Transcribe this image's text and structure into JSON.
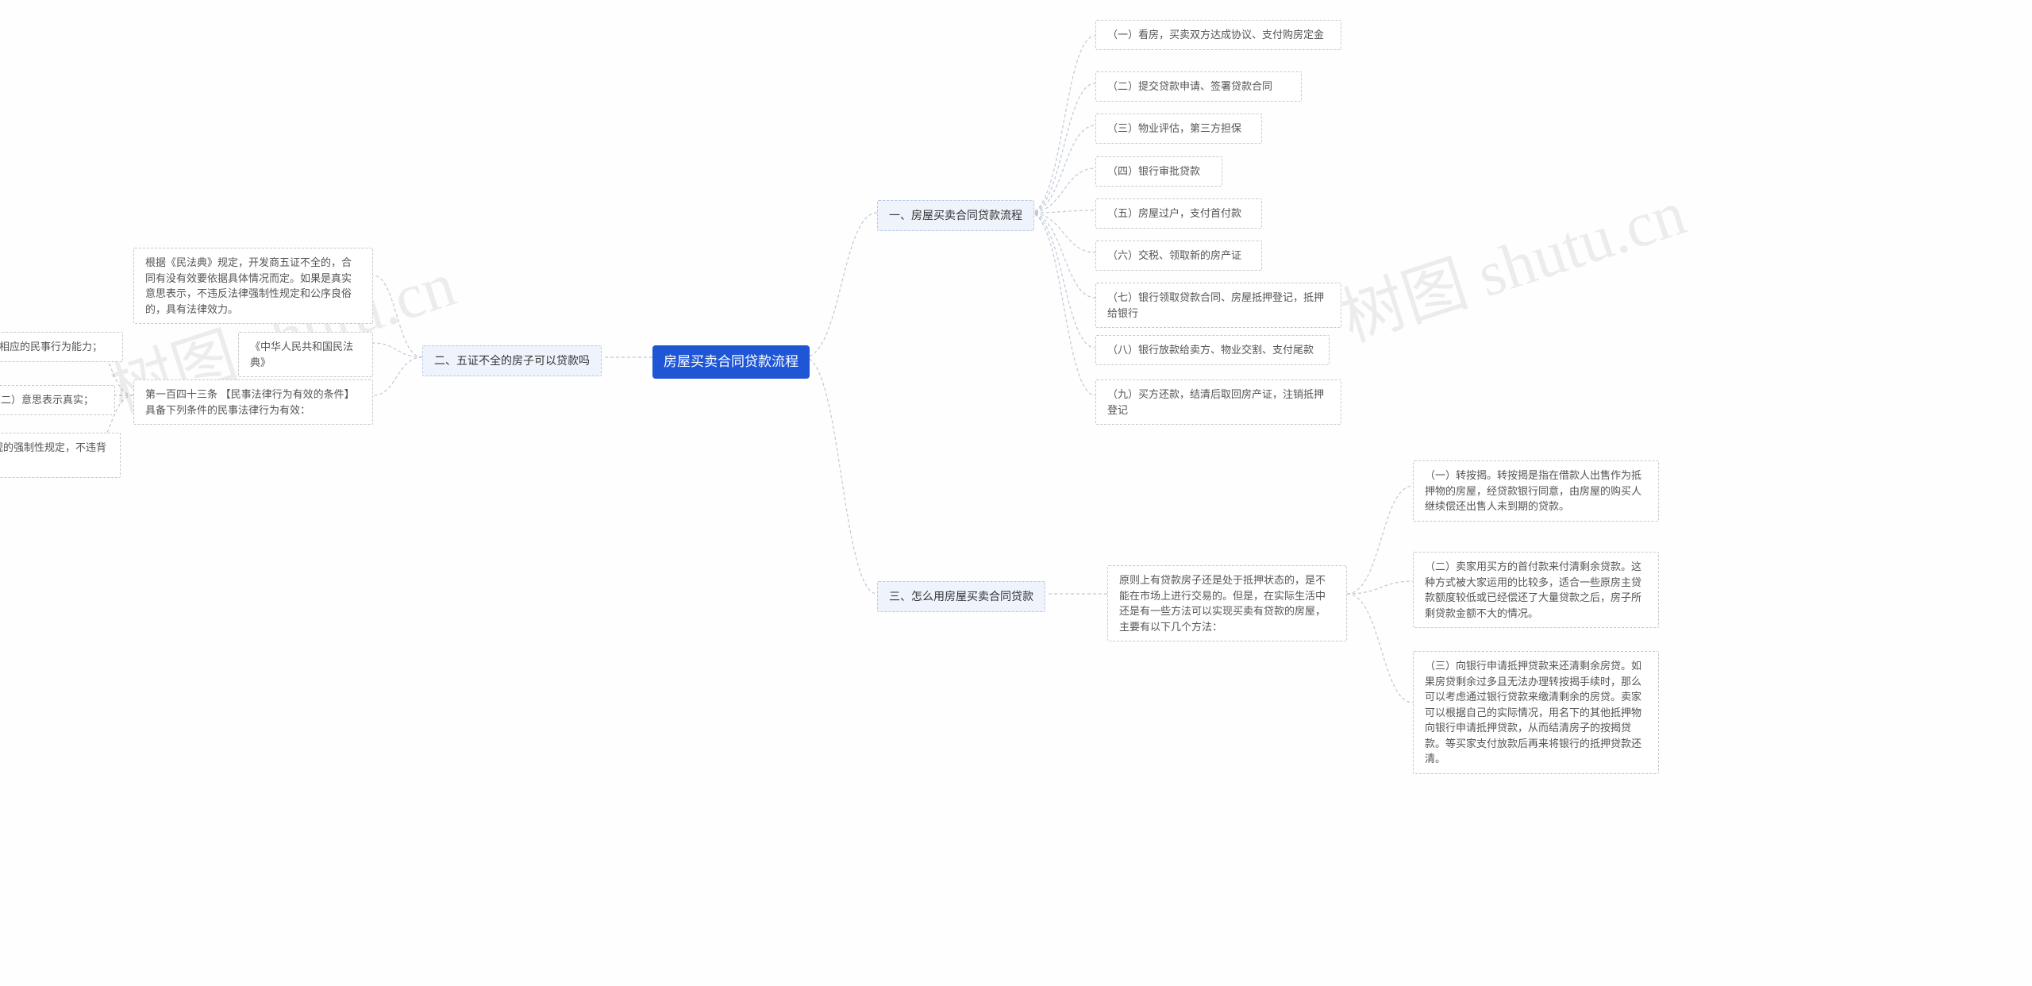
{
  "center": "房屋买卖合同贷款流程",
  "branch1": {
    "title": "一、房屋买卖合同贷款流程",
    "items": [
      "（一）看房，买卖双方达成协议、支付购房定金",
      "（二）提交贷款申请、签署贷款合同",
      "（三）物业评估，第三方担保",
      "（四）银行审批贷款",
      "（五）房屋过户，支付首付款",
      "（六）交税、领取新的房产证",
      "（七）银行领取贷款合同、房屋抵押登记，抵押给银行",
      "（八）银行放款给卖方、物业交割、支付尾款",
      "（九）买方还款，结清后取回房产证，注销抵押登记"
    ]
  },
  "branch2": {
    "title": "二、五证不全的房子可以贷款吗",
    "item1": "根据《民法典》规定，开发商五证不全的，合同有没有效要依据具体情况而定。如果是真实意思表示，不违反法律强制性规定和公序良俗的，具有法律效力。",
    "item2": "《中华人民共和国民法典》",
    "item3": "第一百四十三条 【民事法律行为有效的条件】具备下列条件的民事法律行为有效：",
    "sub": [
      "（一）行为人具有相应的民事行为能力；",
      "（二）意思表示真实；",
      "（三）不违反法律、行政法规的强制性规定，不违背公序良俗。"
    ]
  },
  "branch3": {
    "title": "三、怎么用房屋买卖合同贷款",
    "intro": "原则上有贷款房子还是处于抵押状态的，是不能在市场上进行交易的。但是，在实际生活中还是有一些方法可以实现买卖有贷款的房屋，主要有以下几个方法：",
    "items": [
      "（一）转按揭。转按揭是指在借款人出售作为抵押物的房屋，经贷款银行同意，由房屋的购买人继续偿还出售人未到期的贷款。",
      "（二）卖家用买方的首付款来付清剩余贷款。这种方式被大家运用的比较多，适合一些原房主贷款额度较低或已经偿还了大量贷款之后，房子所剩贷款金额不大的情况。",
      "（三）向银行申请抵押贷款来还清剩余房贷。如果房贷剩余过多且无法办理转按揭手续时，那么可以考虑通过银行贷款来缴清剩余的房贷。卖家可以根据自己的实际情况，用名下的其他抵押物向银行申请抵押贷款，从而结清房子的按揭贷款。等买家支付放款后再来将银行的抵押贷款还清。"
    ]
  },
  "watermarks": [
    "树图 shutu.cn",
    "树图 shutu.cn"
  ]
}
